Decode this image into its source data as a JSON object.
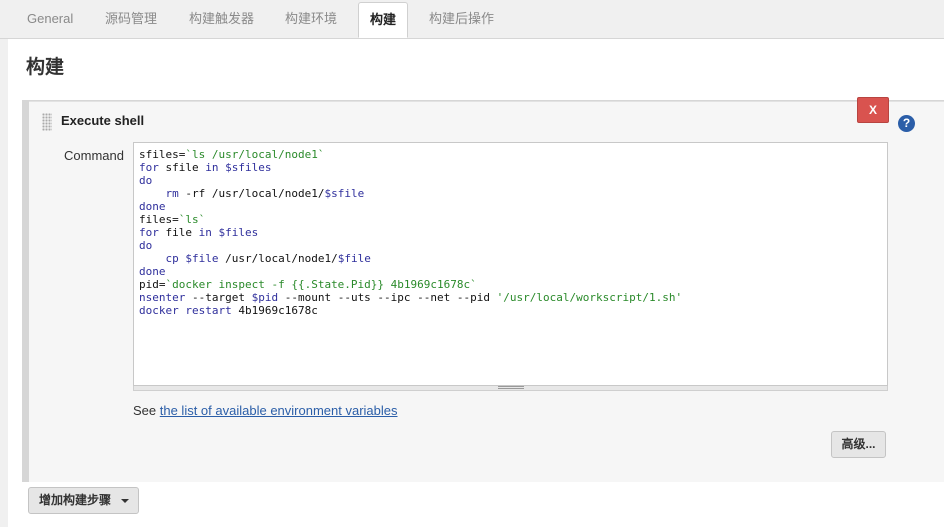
{
  "tabs": [
    {
      "label": "General"
    },
    {
      "label": "源码管理"
    },
    {
      "label": "构建触发器"
    },
    {
      "label": "构建环境"
    },
    {
      "label": "构建"
    },
    {
      "label": "构建后操作"
    }
  ],
  "section_title": "构建",
  "step": {
    "title": "Execute shell",
    "delete_label": "X",
    "help_label": "?",
    "command_label": "Command",
    "command_lines": [
      "sfiles=`ls /usr/local/node1`",
      "for sfile in $sfiles",
      "do",
      "    rm -rf /usr/local/node1/$sfile",
      "done",
      "files=`ls`",
      "for file in $files",
      "do",
      "    cp $file /usr/local/node1/$file",
      "done",
      "pid=`docker inspect -f {{.State.Pid}} 4b1969c1678c`",
      "nsenter --target $pid --mount --uts --ipc --net --pid '/usr/local/workscript/1.sh'",
      "docker restart 4b1969c1678c"
    ],
    "see_prefix": "See ",
    "see_link": "the list of available environment variables",
    "advanced_label": "高级..."
  },
  "add_step_label": "增加构建步骤",
  "colors": {
    "delete": "#d9534f",
    "help": "#2b5ea8",
    "link": "#2b5ea8",
    "keyword": "#2f2f9c",
    "string": "#2a8a2a"
  }
}
